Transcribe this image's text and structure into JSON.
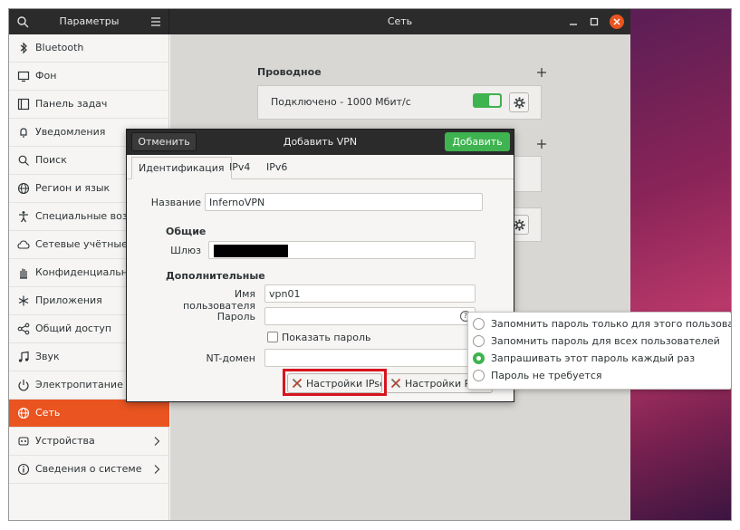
{
  "titlebar": {
    "left_title": "Параметры",
    "main_title": "Сеть"
  },
  "sidebar": {
    "items": [
      {
        "label": "Bluetooth",
        "icon": "bluetooth-icon"
      },
      {
        "label": "Фон",
        "icon": "background-icon"
      },
      {
        "label": "Панель задач",
        "icon": "dock-icon"
      },
      {
        "label": "Уведомления",
        "icon": "bell-icon"
      },
      {
        "label": "Поиск",
        "icon": "search-icon"
      },
      {
        "label": "Регион и язык",
        "icon": "globe-icon"
      },
      {
        "label": "Специальные возможности",
        "icon": "accessibility-icon"
      },
      {
        "label": "Сетевые учётные записи",
        "icon": "cloud-icon"
      },
      {
        "label": "Конфиденциальность",
        "icon": "hand-icon"
      },
      {
        "label": "Приложения",
        "icon": "apps-icon"
      },
      {
        "label": "Общий доступ",
        "icon": "share-icon"
      },
      {
        "label": "Звук",
        "icon": "music-icon"
      },
      {
        "label": "Электропитание",
        "icon": "power-icon"
      },
      {
        "label": "Сеть",
        "icon": "network-icon",
        "active": true
      },
      {
        "label": "Устройства",
        "icon": "devices-icon",
        "chevron": true
      },
      {
        "label": "Сведения о системе",
        "icon": "info-icon",
        "chevron": true
      }
    ]
  },
  "main": {
    "wired_title": "Проводное",
    "wired_status": "Подключено - 1000 Мбит/с"
  },
  "dialog": {
    "cancel_label": "Отменить",
    "title": "Добавить VPN",
    "add_label": "Добавить",
    "tabs": [
      "Идентификация",
      "IPv4",
      "IPv6"
    ],
    "name_label": "Название",
    "name_value": "InfernoVPN",
    "general_heading": "Общие",
    "gateway_label": "Шлюз",
    "advanced_heading": "Дополнительные",
    "username_label": "Имя пользователя",
    "username_value": "vpn01",
    "password_label": "Пароль",
    "password_value": "",
    "show_password_label": "Показать пароль",
    "nt_domain_label": "NT-домен",
    "nt_domain_value": "",
    "ipsec_button": "Настройки IPsec",
    "ppp_button": "Настройки PPP"
  },
  "password_popover": {
    "options": [
      {
        "label": "Запомнить пароль только для этого пользователя",
        "selected": false
      },
      {
        "label": "Запомнить пароль для всех пользователей",
        "selected": false
      },
      {
        "label": "Запрашивать этот пароль каждый раз",
        "selected": true
      },
      {
        "label": "Пароль не требуется",
        "selected": false
      }
    ]
  },
  "colors": {
    "accent": "#e95420",
    "success": "#3eb34f",
    "highlight": "#d8141e"
  }
}
